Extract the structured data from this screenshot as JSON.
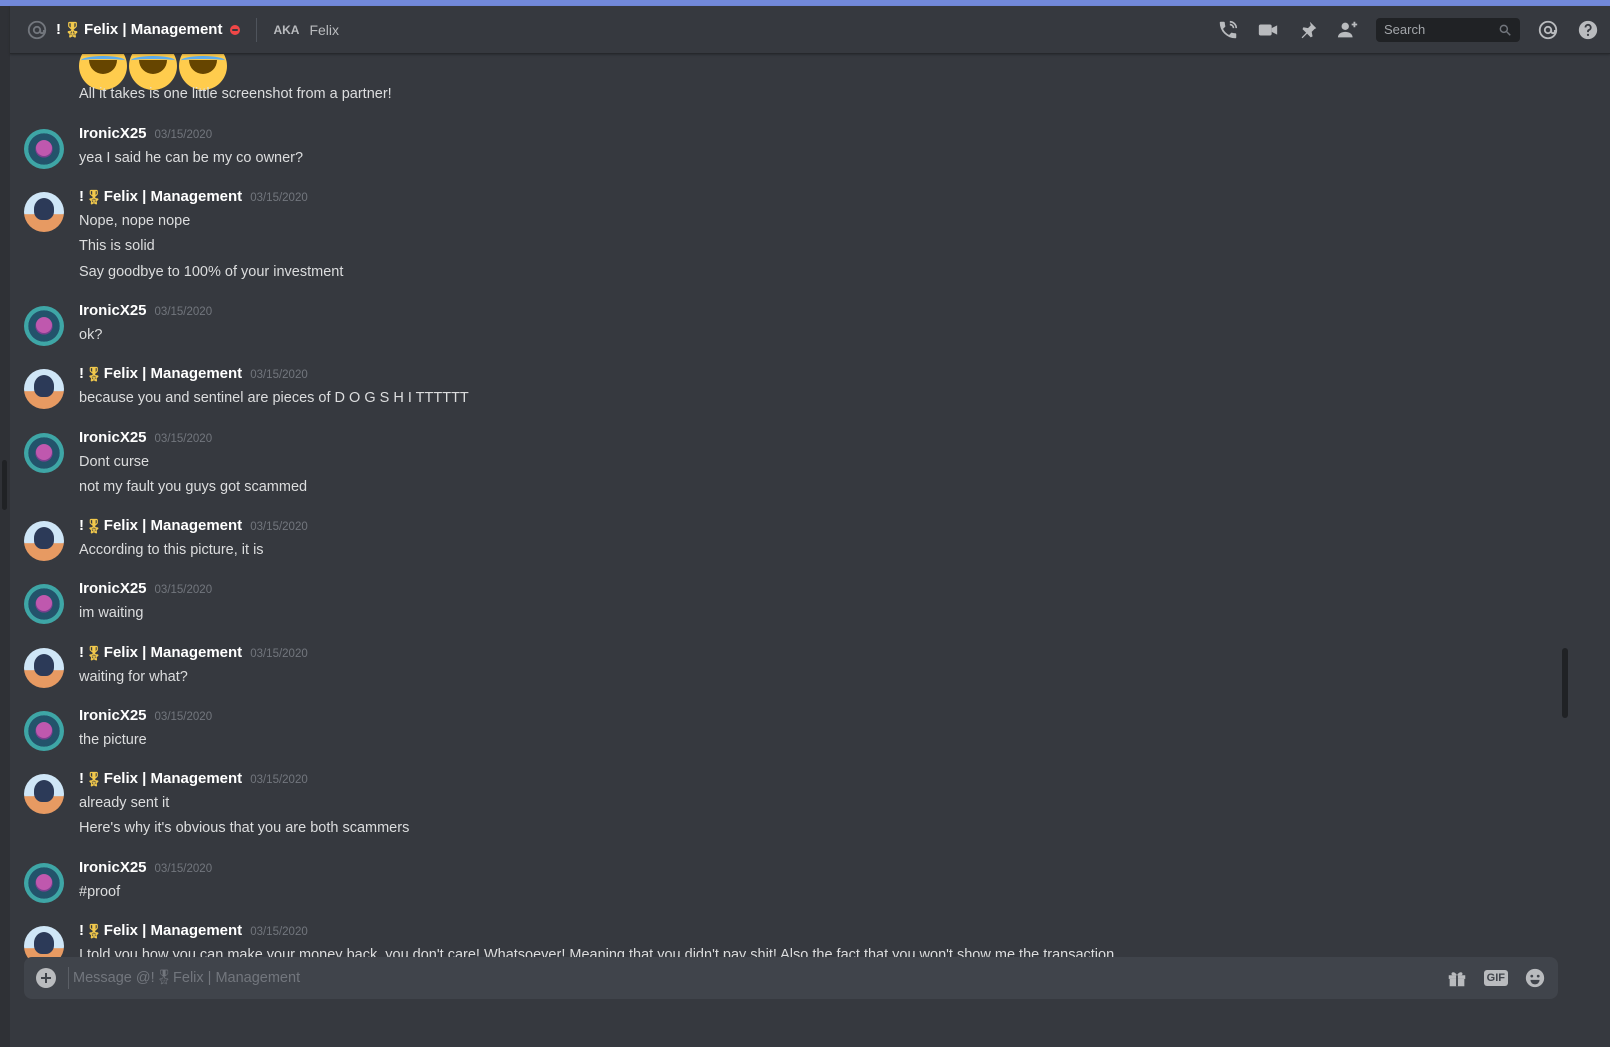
{
  "header": {
    "prefix": "!",
    "badge": "🎖",
    "name": "Felix | Management",
    "aka_label": "AKA",
    "aka_value": "Felix"
  },
  "toolbar": {
    "search_placeholder": "Search"
  },
  "messages": {
    "top_line": "All it takes is one little screenshot from a partner!",
    "groups": [
      {
        "author": "IronicX25",
        "timestamp": "03/15/2020",
        "lines": [
          "yea I said he can be my co owner?"
        ]
      },
      {
        "author": "Felix | Management",
        "prefix": "!",
        "badge": "🎖",
        "timestamp": "03/15/2020",
        "lines": [
          "Nope, nope nope",
          "This is solid",
          "Say goodbye to 100% of your investment"
        ]
      },
      {
        "author": "IronicX25",
        "timestamp": "03/15/2020",
        "lines": [
          "ok?"
        ]
      },
      {
        "author": "Felix | Management",
        "prefix": "!",
        "badge": "🎖",
        "timestamp": "03/15/2020",
        "lines": [
          "because you and sentinel are pieces of D O G S H I  TTTTTT"
        ]
      },
      {
        "author": "IronicX25",
        "timestamp": "03/15/2020",
        "lines": [
          "Dont curse",
          "not my fault you guys got scammed"
        ]
      },
      {
        "author": "Felix | Management",
        "prefix": "!",
        "badge": "🎖",
        "timestamp": "03/15/2020",
        "lines": [
          "According to this picture, it is"
        ]
      },
      {
        "author": "IronicX25",
        "timestamp": "03/15/2020",
        "lines": [
          "im waiting"
        ]
      },
      {
        "author": "Felix | Management",
        "prefix": "!",
        "badge": "🎖",
        "timestamp": "03/15/2020",
        "lines": [
          "waiting for what?"
        ]
      },
      {
        "author": "IronicX25",
        "timestamp": "03/15/2020",
        "lines": [
          "the picture"
        ]
      },
      {
        "author": "Felix | Management",
        "prefix": "!",
        "badge": "🎖",
        "timestamp": "03/15/2020",
        "lines": [
          "already sent it",
          "Here's why it's obvious that you are both scammers"
        ]
      },
      {
        "author": "IronicX25",
        "timestamp": "03/15/2020",
        "lines": [
          "#proof"
        ]
      },
      {
        "author": "Felix | Management",
        "prefix": "!",
        "badge": "🎖",
        "timestamp": "03/15/2020",
        "lines": [
          "I told you how you can make your money back, you don't care! Whatsoever! Meaning that you didn't pay shit! Also the fact that you won't show me the transaction"
        ]
      }
    ]
  },
  "composer": {
    "placeholder": "Message @!🎖Felix | Management",
    "gif_label": "GIF"
  }
}
